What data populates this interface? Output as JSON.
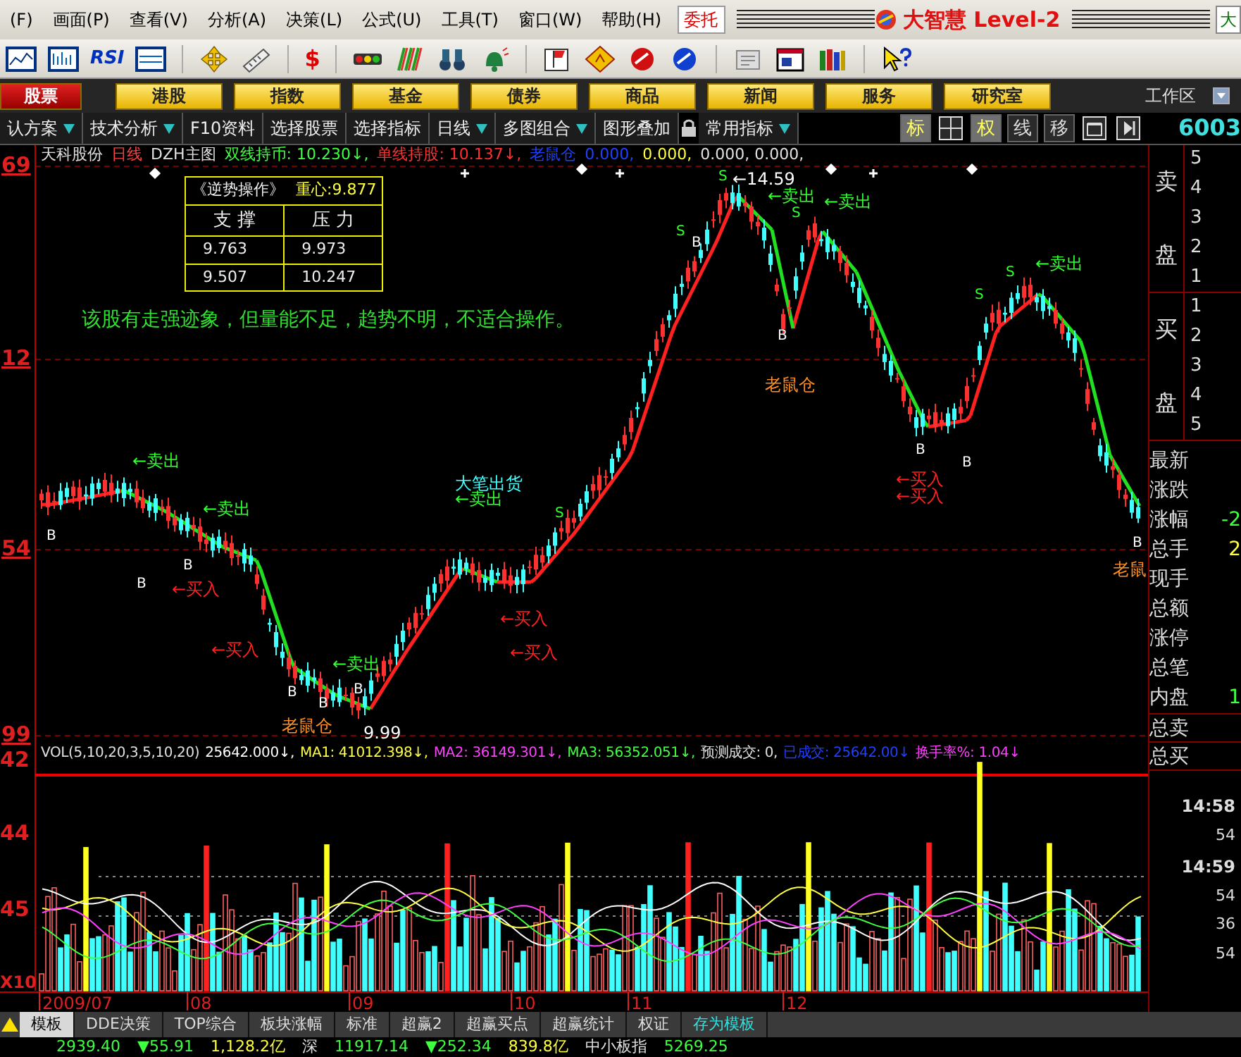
{
  "menu": {
    "items": [
      "(F)",
      "画面(P)",
      "查看(V)",
      "分析(A)",
      "决策(L)",
      "公式(U)",
      "工具(T)",
      "窗口(W)",
      "帮助(H)"
    ],
    "trade_button": "委托",
    "brand": "大智慧 Level-2",
    "edge_button": "大"
  },
  "toolbar": {
    "rsi_label": "RSI",
    "dollar_label": "$"
  },
  "nav": {
    "items": [
      {
        "label": "股票",
        "selected": true
      },
      {
        "label": "港股",
        "selected": false
      },
      {
        "label": "指数",
        "selected": false
      },
      {
        "label": "基金",
        "selected": false
      },
      {
        "label": "债券",
        "selected": false
      },
      {
        "label": "商品",
        "selected": false
      },
      {
        "label": "新闻",
        "selected": false
      },
      {
        "label": "服务",
        "selected": false
      },
      {
        "label": "研究室",
        "selected": false
      }
    ],
    "workspace": "工作区"
  },
  "tabbar": {
    "items": [
      {
        "kind": "menu",
        "label": "认方案",
        "dropdown": true
      },
      {
        "kind": "menu",
        "label": "技术分析",
        "dropdown": true
      },
      {
        "kind": "menu",
        "label": "F10资料",
        "dropdown": false
      },
      {
        "kind": "menu",
        "label": "选择股票",
        "dropdown": false
      },
      {
        "kind": "menu",
        "label": "选择指标",
        "dropdown": false
      },
      {
        "kind": "menu",
        "label": "日线",
        "dropdown": true
      },
      {
        "kind": "menu",
        "label": "多图组合",
        "dropdown": true
      },
      {
        "kind": "menu",
        "label": "图形叠加",
        "dropdown": false
      },
      {
        "kind": "lock"
      },
      {
        "kind": "menu",
        "label": "常用指标",
        "dropdown": true
      }
    ],
    "tools": [
      {
        "kind": "text",
        "label": "标",
        "selected": true
      },
      {
        "kind": "grid"
      },
      {
        "kind": "text",
        "label": "权",
        "selected": true
      },
      {
        "kind": "text",
        "label": "线",
        "selected": false
      },
      {
        "kind": "text",
        "label": "移",
        "selected": false
      },
      {
        "kind": "restore"
      },
      {
        "kind": "next"
      }
    ],
    "stock_code": "6003"
  },
  "chart": {
    "info": [
      {
        "text": "天科股份",
        "color": "#e0e0e0"
      },
      {
        "text": "日线",
        "color": "#ff4040"
      },
      {
        "text": "DZH主图",
        "color": "#e0e0e0"
      },
      {
        "text": "双线持币: 10.230↓,",
        "color": "#40ff40"
      },
      {
        "text": "单线持股: 10.137↓,",
        "color": "#ff3030"
      },
      {
        "text": "老鼠仓",
        "color": "#2040ff"
      },
      {
        "text": "0.000,",
        "color": "#2040ff"
      },
      {
        "text": "0.000,",
        "color": "#ffff40"
      },
      {
        "text": "0.000, 0.000,",
        "color": "#e0e0e0"
      }
    ],
    "y_labels": [
      "69",
      "12",
      "54",
      "99"
    ],
    "support_box": {
      "title": "《逆势操作》",
      "center": "重心:9.877",
      "headers": [
        "支 撑",
        "压 力"
      ],
      "rows": [
        [
          "9.763",
          "9.973"
        ],
        [
          "9.507",
          "10.247"
        ]
      ]
    },
    "comment": "该股有走强迹象，但量能不足，趋势不明，不适合操作。",
    "annotations": [
      {
        "text": "←卖出",
        "kind": "sell"
      },
      {
        "text": "←卖出",
        "kind": "sell"
      },
      {
        "text": "←卖出",
        "kind": "sell"
      },
      {
        "text": "大笔出货",
        "kind": "big"
      },
      {
        "text": "←卖出",
        "kind": "sell"
      },
      {
        "text": "S",
        "kind": "s"
      },
      {
        "text": "S",
        "kind": "s"
      },
      {
        "text": "S",
        "kind": "s"
      },
      {
        "text": "←14.59",
        "kind": "price"
      },
      {
        "text": "←卖出",
        "kind": "sell"
      },
      {
        "text": "S",
        "kind": "s"
      },
      {
        "text": "←卖出",
        "kind": "sell"
      },
      {
        "text": "S",
        "kind": "s"
      },
      {
        "text": "S",
        "kind": "s"
      },
      {
        "text": "←卖出",
        "kind": "sell"
      },
      {
        "text": "←买入",
        "kind": "buy"
      },
      {
        "text": "←买入",
        "kind": "buy"
      },
      {
        "text": "←买入",
        "kind": "buy"
      },
      {
        "text": "←买入",
        "kind": "buy"
      },
      {
        "text": "←买入",
        "kind": "buy"
      },
      {
        "text": "←买入",
        "kind": "buy"
      },
      {
        "text": "老鼠仓",
        "kind": "rat"
      },
      {
        "text": "老鼠仓",
        "kind": "rat"
      },
      {
        "text": "老鼠",
        "kind": "rat"
      },
      {
        "text": "9.99",
        "kind": "price"
      },
      {
        "text": "B",
        "kind": "b"
      },
      {
        "text": "B",
        "kind": "b"
      },
      {
        "text": "B",
        "kind": "b"
      },
      {
        "text": "B",
        "kind": "b"
      },
      {
        "text": "B",
        "kind": "b"
      },
      {
        "text": "B",
        "kind": "b"
      },
      {
        "text": "B",
        "kind": "b"
      },
      {
        "text": "B",
        "kind": "b"
      },
      {
        "text": "B",
        "kind": "b"
      },
      {
        "text": "B",
        "kind": "b"
      },
      {
        "text": "B",
        "kind": "b"
      }
    ],
    "volume_info": [
      {
        "text": "VOL(5,10,20,3,5,10,20)",
        "color": "#e0e0e0"
      },
      {
        "text": "25642.000↓,",
        "color": "#ffffff"
      },
      {
        "text": "MA1: 41012.398↓,",
        "color": "#ffff40"
      },
      {
        "text": "MA2: 36149.301↓,",
        "color": "#ff40ff"
      },
      {
        "text": "MA3: 56352.051↓,",
        "color": "#40ff40"
      },
      {
        "text": "预测成交: 0,",
        "color": "#e0e0e0"
      },
      {
        "text": "已成交: 25642.00↓",
        "color": "#2040ff"
      },
      {
        "text": "换手率%: 1.04↓",
        "color": "#ff40ff"
      }
    ],
    "volume_labels": [
      "42",
      "44",
      "45",
      "X10"
    ],
    "x_labels": [
      "2009/07",
      "08",
      "09",
      "10",
      "11",
      "12"
    ]
  },
  "quote": {
    "sell_label": [
      "卖",
      "盘"
    ],
    "sell_levels": [
      "5",
      "4",
      "3",
      "2",
      "1"
    ],
    "buy_label": [
      "买",
      "盘"
    ],
    "buy_levels": [
      "1",
      "2",
      "3",
      "4",
      "5"
    ],
    "rows": [
      {
        "label": "最新"
      },
      {
        "label": "涨跌"
      },
      {
        "label": "涨幅",
        "value": "-2",
        "color": "#40ff40"
      },
      {
        "label": "总手",
        "value": "2",
        "color": "#ffff40"
      },
      {
        "label": "现手"
      },
      {
        "label": "总额"
      },
      {
        "label": "涨停"
      },
      {
        "label": "总笔"
      },
      {
        "label": "内盘",
        "value": "1",
        "color": "#40ff40"
      }
    ],
    "totals": [
      "总卖",
      "总买"
    ],
    "ticks": [
      "14:58",
      "54",
      "14:59",
      "54",
      "36",
      "54"
    ]
  },
  "bottom_tabs": [
    {
      "label": "模板",
      "selected": true,
      "kind": "tab"
    },
    {
      "label": "DDE决策",
      "selected": false,
      "kind": "tab"
    },
    {
      "label": "TOP综合",
      "selected": false,
      "kind": "tab"
    },
    {
      "label": "板块涨幅",
      "selected": false,
      "kind": "tab"
    },
    {
      "label": "标准",
      "selected": false,
      "kind": "tab"
    },
    {
      "label": "超赢2",
      "selected": false,
      "kind": "tab"
    },
    {
      "label": "超赢买点",
      "selected": false,
      "kind": "tab"
    },
    {
      "label": "超赢统计",
      "selected": false,
      "kind": "tab"
    },
    {
      "label": "权证",
      "selected": false,
      "kind": "tab"
    },
    {
      "label": "存为模板",
      "selected": false,
      "kind": "action"
    }
  ],
  "status": [
    {
      "text": "2939.40",
      "color": "#40ff40"
    },
    {
      "text": "▼55.91",
      "color": "#40ff40"
    },
    {
      "text": "1,128.2亿",
      "color": "#ffff40"
    },
    {
      "text": "深",
      "color": "#e0e0e0"
    },
    {
      "text": "11917.14",
      "color": "#40ff40"
    },
    {
      "text": "▼252.34",
      "color": "#40ff40"
    },
    {
      "text": "839.8亿",
      "color": "#ffff40"
    },
    {
      "text": "中小板指",
      "color": "#e0e0e0"
    },
    {
      "text": "5269.25",
      "color": "#40ff40"
    }
  ]
}
